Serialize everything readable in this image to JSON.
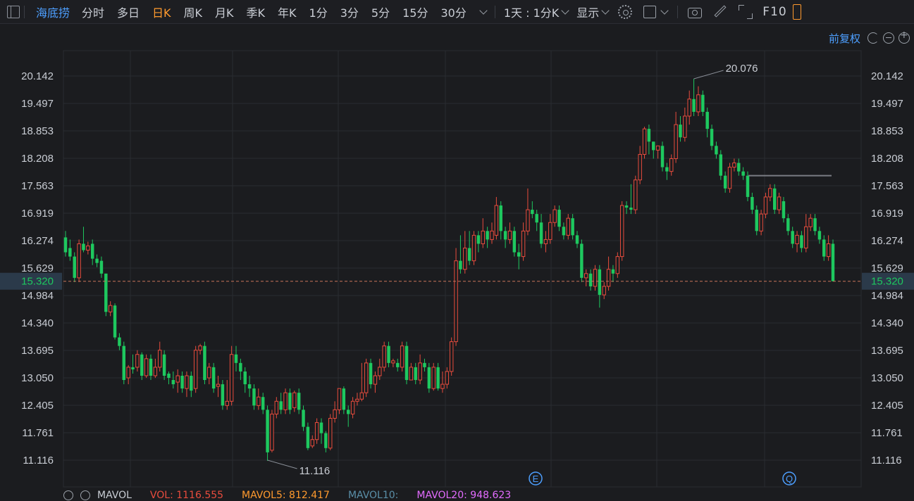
{
  "toolbar": {
    "stock_name": "海底捞",
    "tabs": [
      "分时",
      "多日",
      "日K",
      "周K",
      "月K",
      "季K",
      "年K",
      "1分",
      "3分",
      "5分",
      "15分",
      "30分"
    ],
    "active_tab": "日K",
    "period_dropdown": "1天 : 1分K",
    "display_dropdown": "显示",
    "f10_label": "F10",
    "adjust_label": "前复权"
  },
  "colors": {
    "up": "#e84c3d",
    "down": "#1ec85f",
    "background": "#1b1c1f",
    "grid": "#2a2c31",
    "link": "#4d9fff",
    "active_tab": "#ff9a2e"
  },
  "icons": [
    "panel-icon",
    "chevron-down-icon",
    "gear-icon",
    "square-icon",
    "camera-icon",
    "pencil-icon",
    "expand-icon",
    "undo-icon",
    "zoom-out-icon",
    "zoom-in-icon",
    "settings-icon",
    "close-icon",
    "event-e-icon",
    "event-q-icon"
  ],
  "indicator_bar": {
    "name": "MAVOL",
    "vol": "VOL: 1116.555",
    "ma5": "MAVOL5: 812.417",
    "ma10": "MAVOL10:",
    "ma20": "MAVOL20: 948.623",
    "ma20_color": "#e36cff",
    "ma5_color": "#ff9a2e",
    "vol_color": "#e84c3d",
    "ma10_color": "#5a8fa8"
  },
  "chart_data": {
    "type": "candlestick",
    "y_ticks": [
      "20.142",
      "19.497",
      "18.853",
      "18.208",
      "17.563",
      "16.919",
      "16.274",
      "15.629",
      "14.984",
      "14.340",
      "13.695",
      "13.050",
      "12.405",
      "11.761",
      "11.116"
    ],
    "ylim": [
      10.9,
      20.6
    ],
    "last_price": "15.320",
    "last_price_value": 15.32,
    "high_label": "20.076",
    "high_value": 20.076,
    "low_label": "11.116",
    "low_value": 11.116,
    "event_markers": [
      "E",
      "Q"
    ],
    "resistance_line": 17.8,
    "candles": [
      [
        16.35,
        16.0,
        16.5,
        15.9
      ],
      [
        16.1,
        15.9,
        16.3,
        15.8
      ],
      [
        15.9,
        15.4,
        16.0,
        15.3
      ],
      [
        15.4,
        16.2,
        16.3,
        15.3
      ],
      [
        16.2,
        16.05,
        16.6,
        16.0
      ],
      [
        16.05,
        16.15,
        16.25,
        15.95
      ],
      [
        16.2,
        15.85,
        16.3,
        15.7
      ],
      [
        15.85,
        15.75,
        15.95,
        15.65
      ],
      [
        15.8,
        15.5,
        15.9,
        15.4
      ],
      [
        15.5,
        14.6,
        15.5,
        14.5
      ],
      [
        14.6,
        14.75,
        14.85,
        14.5
      ],
      [
        14.75,
        14.0,
        14.8,
        13.95
      ],
      [
        14.0,
        13.8,
        14.1,
        13.7
      ],
      [
        13.8,
        13.0,
        13.9,
        12.9
      ],
      [
        13.05,
        13.3,
        13.35,
        12.9
      ],
      [
        13.3,
        13.25,
        13.6,
        13.15
      ],
      [
        13.3,
        13.6,
        13.7,
        13.2
      ],
      [
        13.6,
        13.1,
        13.65,
        13.0
      ],
      [
        13.1,
        13.5,
        13.6,
        13.05
      ],
      [
        13.5,
        13.1,
        13.6,
        13.0
      ],
      [
        13.1,
        13.3,
        13.5,
        13.05
      ],
      [
        13.3,
        13.7,
        13.9,
        13.2
      ],
      [
        13.6,
        13.1,
        13.7,
        13.0
      ],
      [
        13.15,
        13.05,
        13.2,
        12.9
      ],
      [
        13.0,
        12.9,
        13.2,
        12.8
      ],
      [
        12.95,
        13.1,
        13.25,
        12.7
      ],
      [
        13.1,
        12.8,
        13.2,
        12.7
      ],
      [
        12.8,
        13.1,
        13.2,
        12.6
      ],
      [
        13.1,
        12.75,
        13.2,
        12.6
      ],
      [
        12.8,
        13.7,
        13.8,
        12.7
      ],
      [
        13.7,
        13.8,
        13.85,
        13.6
      ],
      [
        13.8,
        13.0,
        13.9,
        12.9
      ],
      [
        13.05,
        13.3,
        13.4,
        12.9
      ],
      [
        13.3,
        12.8,
        13.4,
        12.7
      ],
      [
        12.85,
        12.9,
        13.1,
        12.6
      ],
      [
        12.9,
        12.4,
        13.0,
        12.3
      ],
      [
        12.4,
        12.5,
        13.0,
        12.3
      ],
      [
        12.5,
        13.6,
        13.8,
        12.4
      ],
      [
        13.6,
        13.4,
        13.8,
        13.2
      ],
      [
        13.4,
        13.2,
        13.5,
        13.0
      ],
      [
        13.2,
        12.9,
        13.3,
        12.7
      ],
      [
        12.9,
        12.8,
        13.1,
        12.6
      ],
      [
        12.8,
        12.4,
        12.9,
        12.3
      ],
      [
        12.4,
        12.6,
        12.8,
        12.3
      ],
      [
        12.6,
        12.3,
        12.7,
        12.2
      ],
      [
        12.3,
        11.3,
        12.4,
        11.1
      ],
      [
        11.35,
        12.2,
        12.3,
        11.3
      ],
      [
        12.2,
        12.5,
        12.6,
        12.1
      ],
      [
        12.5,
        12.3,
        12.7,
        12.2
      ],
      [
        12.3,
        12.7,
        12.8,
        12.2
      ],
      [
        12.7,
        12.3,
        12.8,
        12.2
      ],
      [
        12.35,
        12.7,
        12.75,
        12.25
      ],
      [
        12.7,
        12.3,
        12.8,
        12.2
      ],
      [
        12.3,
        11.9,
        12.4,
        11.8
      ],
      [
        11.9,
        11.4,
        12.0,
        11.35
      ],
      [
        11.45,
        11.6,
        11.7,
        11.4
      ],
      [
        11.6,
        12.0,
        12.1,
        11.5
      ],
      [
        12.0,
        11.75,
        12.1,
        11.5
      ],
      [
        11.75,
        11.4,
        11.8,
        11.3
      ],
      [
        11.4,
        12.1,
        12.2,
        11.35
      ],
      [
        12.1,
        12.3,
        12.5,
        12.0
      ],
      [
        12.3,
        12.8,
        12.8,
        12.2
      ],
      [
        12.8,
        12.3,
        12.85,
        12.2
      ],
      [
        12.3,
        12.2,
        12.4,
        11.9
      ],
      [
        12.2,
        12.5,
        12.6,
        12.1
      ],
      [
        12.5,
        12.55,
        12.7,
        12.4
      ],
      [
        12.55,
        12.7,
        13.4,
        12.5
      ],
      [
        12.7,
        13.4,
        13.5,
        12.6
      ],
      [
        13.4,
        12.9,
        13.5,
        12.8
      ],
      [
        12.9,
        13.1,
        13.2,
        12.7
      ],
      [
        13.1,
        13.3,
        13.5,
        13.0
      ],
      [
        13.3,
        13.8,
        13.9,
        13.2
      ],
      [
        13.8,
        13.4,
        13.9,
        13.3
      ],
      [
        13.4,
        13.45,
        13.5,
        13.3
      ],
      [
        13.4,
        13.3,
        13.5,
        13.2
      ],
      [
        13.3,
        13.8,
        13.9,
        13.2
      ],
      [
        13.8,
        13.0,
        13.9,
        12.9
      ],
      [
        13.0,
        13.3,
        13.4,
        13.0
      ],
      [
        13.3,
        13.0,
        13.4,
        12.9
      ],
      [
        13.0,
        13.4,
        13.6,
        12.9
      ],
      [
        13.4,
        13.3,
        13.5,
        13.2
      ],
      [
        13.3,
        12.8,
        13.4,
        12.7
      ],
      [
        12.8,
        13.3,
        13.4,
        12.75
      ],
      [
        13.3,
        12.8,
        13.4,
        12.75
      ],
      [
        12.8,
        12.9,
        13.2,
        12.7
      ],
      [
        12.9,
        13.2,
        13.3,
        12.8
      ],
      [
        13.2,
        13.9,
        14.0,
        13.1
      ],
      [
        13.9,
        15.8,
        16.1,
        13.8
      ],
      [
        15.8,
        15.6,
        16.4,
        15.5
      ],
      [
        15.6,
        16.1,
        16.5,
        15.5
      ],
      [
        16.1,
        15.8,
        16.5,
        15.7
      ],
      [
        15.8,
        16.4,
        16.5,
        15.7
      ],
      [
        16.4,
        16.2,
        16.5,
        16.0
      ],
      [
        16.2,
        16.5,
        16.8,
        16.1
      ],
      [
        16.5,
        16.3,
        16.6,
        16.1
      ],
      [
        16.3,
        16.5,
        16.7,
        16.2
      ],
      [
        16.4,
        17.1,
        17.3,
        16.3
      ],
      [
        17.1,
        16.5,
        17.2,
        16.3
      ],
      [
        16.5,
        16.3,
        16.6,
        16.1
      ],
      [
        16.3,
        16.5,
        16.7,
        16.2
      ],
      [
        16.5,
        16.0,
        16.6,
        15.9
      ],
      [
        16.0,
        15.9,
        16.2,
        15.6
      ],
      [
        15.9,
        16.5,
        16.7,
        15.8
      ],
      [
        16.5,
        17.0,
        17.5,
        16.4
      ],
      [
        17.0,
        16.9,
        17.2,
        16.8
      ],
      [
        16.9,
        16.7,
        17.0,
        16.5
      ],
      [
        16.7,
        16.2,
        16.9,
        16.1
      ],
      [
        16.2,
        16.3,
        16.5,
        16.0
      ],
      [
        16.3,
        16.7,
        16.9,
        16.2
      ],
      [
        16.7,
        17.0,
        17.1,
        16.6
      ],
      [
        17.0,
        16.6,
        17.1,
        16.5
      ],
      [
        16.6,
        16.4,
        16.7,
        16.3
      ],
      [
        16.4,
        16.8,
        16.9,
        16.3
      ],
      [
        16.8,
        16.4,
        16.9,
        16.3
      ],
      [
        16.4,
        16.2,
        16.5,
        16.1
      ],
      [
        16.2,
        15.4,
        16.3,
        15.3
      ],
      [
        15.4,
        15.5,
        15.6,
        15.2
      ],
      [
        15.5,
        15.2,
        15.6,
        15.1
      ],
      [
        15.2,
        15.6,
        15.7,
        15.1
      ],
      [
        15.6,
        15.0,
        15.7,
        14.7
      ],
      [
        15.0,
        15.2,
        15.3,
        14.9
      ],
      [
        15.2,
        15.6,
        15.9,
        15.1
      ],
      [
        15.6,
        15.5,
        15.7,
        15.3
      ],
      [
        15.5,
        15.9,
        16.0,
        15.4
      ],
      [
        15.9,
        17.1,
        17.2,
        15.8
      ],
      [
        17.1,
        17.05,
        17.2,
        16.9
      ],
      [
        17.05,
        17.0,
        17.6,
        16.9
      ],
      [
        17.0,
        17.7,
        17.8,
        16.9
      ],
      [
        17.7,
        18.3,
        18.5,
        17.6
      ],
      [
        18.3,
        18.9,
        18.95,
        18.2
      ],
      [
        18.9,
        18.6,
        19.0,
        18.3
      ],
      [
        18.6,
        18.4,
        18.6,
        18.2
      ],
      [
        18.4,
        18.5,
        18.5,
        18.2
      ],
      [
        18.5,
        18.0,
        18.6,
        17.9
      ],
      [
        18.0,
        17.9,
        18.1,
        17.7
      ],
      [
        17.9,
        18.2,
        18.3,
        17.8
      ],
      [
        18.2,
        19.0,
        19.3,
        18.1
      ],
      [
        19.0,
        18.7,
        19.2,
        18.6
      ],
      [
        18.7,
        19.2,
        19.4,
        18.6
      ],
      [
        19.2,
        19.6,
        19.8,
        19.0
      ],
      [
        19.6,
        19.3,
        20.076,
        19.2
      ],
      [
        19.3,
        19.7,
        19.9,
        19.2
      ],
      [
        19.7,
        19.3,
        19.8,
        19.2
      ],
      [
        19.3,
        18.9,
        19.4,
        18.7
      ],
      [
        18.9,
        18.5,
        19.0,
        18.4
      ],
      [
        18.5,
        18.3,
        18.6,
        18.2
      ],
      [
        18.3,
        17.8,
        18.4,
        17.7
      ],
      [
        17.8,
        17.5,
        17.9,
        17.4
      ],
      [
        17.5,
        18.0,
        18.1,
        17.4
      ],
      [
        18.0,
        18.1,
        18.2,
        17.9
      ],
      [
        18.1,
        17.9,
        18.2,
        17.8
      ],
      [
        17.9,
        17.8,
        18.0,
        17.7
      ],
      [
        17.8,
        17.3,
        17.9,
        17.2
      ],
      [
        17.3,
        17.0,
        17.4,
        16.9
      ],
      [
        17.0,
        16.5,
        17.1,
        16.4
      ],
      [
        16.5,
        16.9,
        17.0,
        16.4
      ],
      [
        16.9,
        17.3,
        17.4,
        16.8
      ],
      [
        17.3,
        17.5,
        17.6,
        17.2
      ],
      [
        17.5,
        17.0,
        17.6,
        16.9
      ],
      [
        17.0,
        17.3,
        17.4,
        16.9
      ],
      [
        17.2,
        16.8,
        17.3,
        16.7
      ],
      [
        16.8,
        16.5,
        16.9,
        16.4
      ],
      [
        16.5,
        16.2,
        16.6,
        16.1
      ],
      [
        16.2,
        16.4,
        16.5,
        16.0
      ],
      [
        16.4,
        16.1,
        16.5,
        16.0
      ],
      [
        16.1,
        16.6,
        16.9,
        16.0
      ],
      [
        16.6,
        16.8,
        16.9,
        16.5
      ],
      [
        16.8,
        16.5,
        16.9,
        16.4
      ],
      [
        16.5,
        16.3,
        16.6,
        16.2
      ],
      [
        16.3,
        15.9,
        16.4,
        15.8
      ],
      [
        15.9,
        16.2,
        16.4,
        15.8
      ],
      [
        16.2,
        15.32,
        16.3,
        15.32
      ]
    ]
  }
}
